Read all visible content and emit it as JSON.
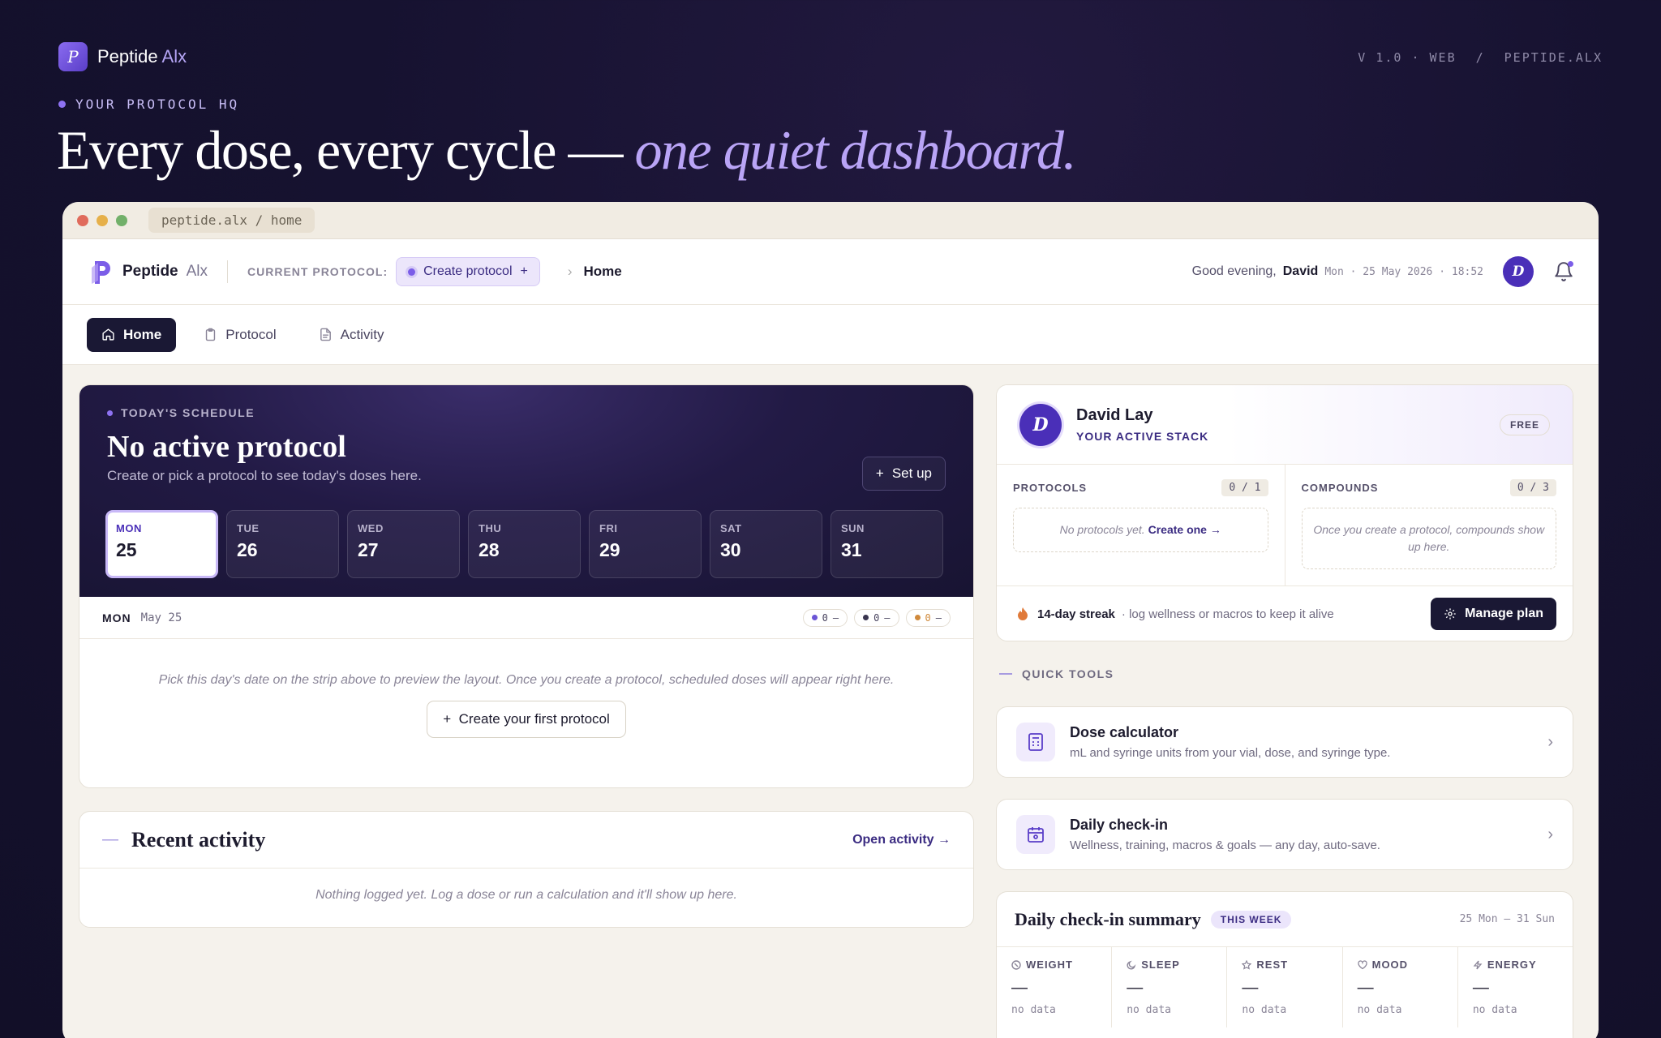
{
  "top": {
    "brand_name": "Peptide",
    "brand_suffix": "Alx",
    "logo_letter": "P",
    "version": "V 1.0 · WEB",
    "separator": "/",
    "domain": "PEPTIDE.ALX",
    "tagline": "YOUR PROTOCOL HQ",
    "headline_main": "Every dose, every cycle — ",
    "headline_accent": "one quiet dashboard."
  },
  "browser": {
    "url": "peptide.alx / home"
  },
  "appbar": {
    "brand_name": "Peptide",
    "brand_suffix": "Alx",
    "current_protocol_label": "CURRENT PROTOCOL:",
    "create_protocol_label": "Create protocol",
    "create_protocol_plus": "+",
    "breadcrumb_chevron": "›",
    "breadcrumb": "Home",
    "greeting": "Good evening,",
    "user_first_name": "David",
    "datetime": "Mon · 25 May 2026 · 18:52",
    "avatar_letter": "D"
  },
  "nav": {
    "tabs": [
      {
        "label": "Home",
        "icon": "home-icon",
        "active": true
      },
      {
        "label": "Protocol",
        "icon": "clipboard-icon",
        "active": false
      },
      {
        "label": "Activity",
        "icon": "document-icon",
        "active": false
      }
    ]
  },
  "schedule": {
    "label": "TODAY'S SCHEDULE",
    "title": "No active protocol",
    "subtitle": "Create or pick a protocol to see today's doses here.",
    "setup_plus": "+",
    "setup_label": "Set up",
    "days": [
      {
        "name": "MON",
        "date": "25",
        "selected": true
      },
      {
        "name": "TUE",
        "date": "26",
        "selected": false
      },
      {
        "name": "WED",
        "date": "27",
        "selected": false
      },
      {
        "name": "THU",
        "date": "28",
        "selected": false
      },
      {
        "name": "FRI",
        "date": "29",
        "selected": false
      },
      {
        "name": "SAT",
        "date": "30",
        "selected": false
      },
      {
        "name": "SUN",
        "date": "31",
        "selected": false
      }
    ],
    "bar_day": "MON",
    "bar_date": "May 25",
    "chips": [
      {
        "count": "0",
        "dash": "—",
        "color": "#6b55d6"
      },
      {
        "count": "0",
        "dash": "—",
        "color": "#3a3650"
      },
      {
        "count": "0",
        "dash": "—",
        "color": "#d08a3c"
      }
    ],
    "empty_text": "Pick this day's date on the strip above to preview the layout. Once you create a protocol, scheduled doses will appear right here.",
    "create_first_plus": "+",
    "create_first_label": "Create your first protocol"
  },
  "recent": {
    "dash": "—",
    "title": "Recent activity",
    "open_link": "Open activity →",
    "empty_text": "Nothing logged yet. Log a dose or run a calculation and it'll show up here."
  },
  "profile": {
    "avatar_letter": "D",
    "name": "David Lay",
    "stack_label": "YOUR ACTIVE STACK",
    "plan_badge": "FREE",
    "protocols_label": "PROTOCOLS",
    "protocols_count": "0 / 1",
    "protocols_empty": "No protocols yet.",
    "protocols_create": "Create one →",
    "compounds_label": "COMPOUNDS",
    "compounds_count": "0 / 3",
    "compounds_empty": "Once you create a protocol, compounds show up here.",
    "streak_bold": "14-day streak",
    "streak_rest": "· log wellness or macros to keep it alive",
    "manage_label": "Manage plan"
  },
  "quick_tools": {
    "label": "QUICK TOOLS",
    "tools": [
      {
        "name": "Dose calculator",
        "desc": "mL and syringe units from your vial, dose, and syringe type.",
        "icon": "calculator-icon"
      },
      {
        "name": "Daily check-in",
        "desc": "Wellness, training, macros & goals — any day, auto-save.",
        "icon": "calendar-icon"
      }
    ],
    "chevron": "›"
  },
  "summary": {
    "title": "Daily check-in summary",
    "badge": "THIS WEEK",
    "range": "25 Mon – 31 Sun",
    "metrics": [
      {
        "label": "WEIGHT",
        "icon": "scale-icon",
        "value": "—",
        "status": "no data"
      },
      {
        "label": "SLEEP",
        "icon": "moon-icon",
        "value": "—",
        "status": "no data"
      },
      {
        "label": "REST",
        "icon": "star-icon",
        "value": "—",
        "status": "no data"
      },
      {
        "label": "MOOD",
        "icon": "heart-icon",
        "value": "—",
        "status": "no data"
      },
      {
        "label": "ENERGY",
        "icon": "bolt-icon",
        "value": "—",
        "status": "no data"
      }
    ]
  },
  "colors": {
    "accent": "#7b5de8",
    "dark": "#1a1834",
    "avatar": "#4a2fb8"
  }
}
